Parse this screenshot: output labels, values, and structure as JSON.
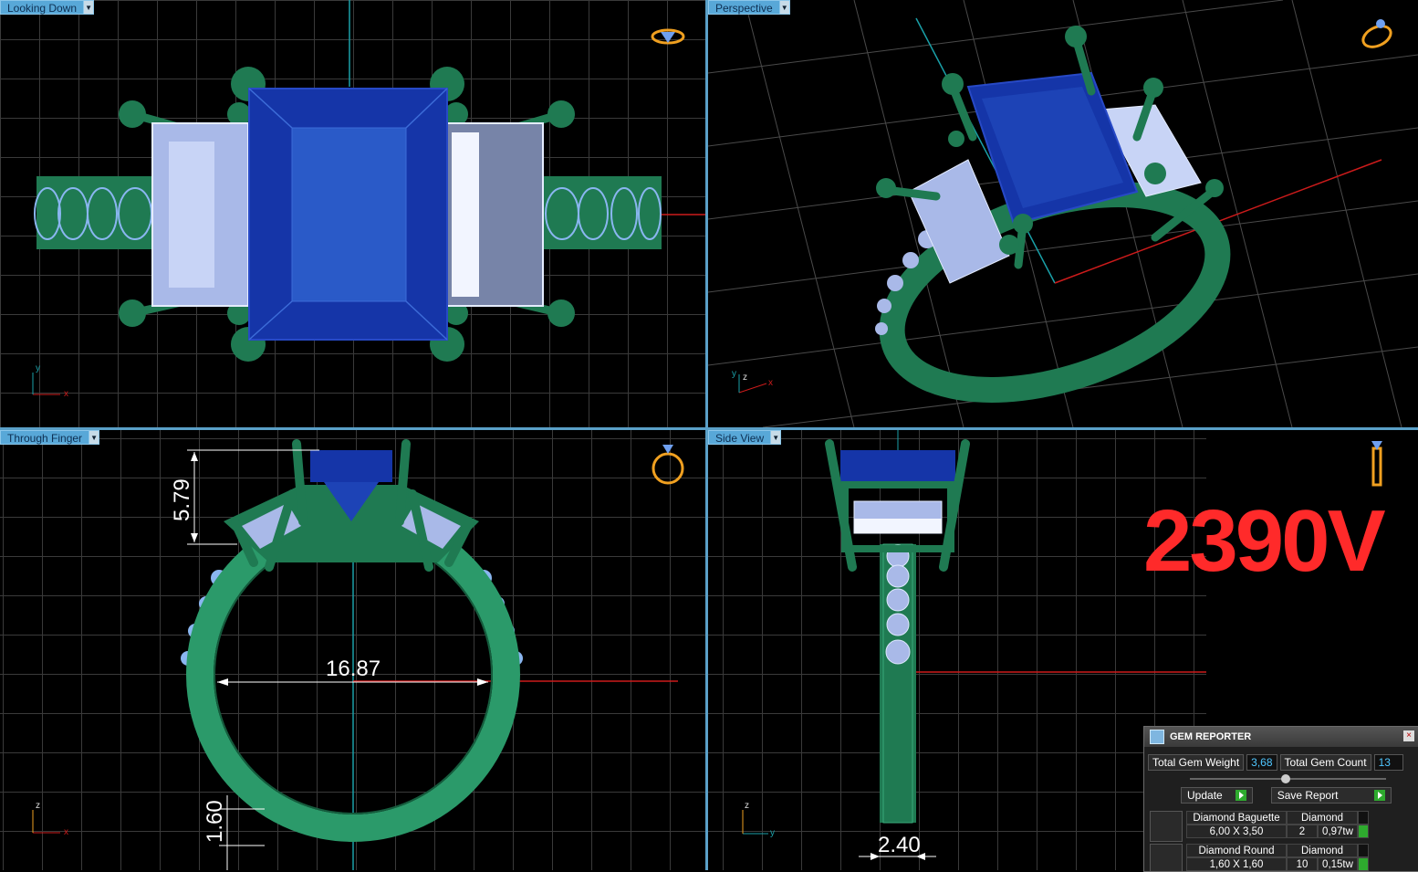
{
  "viewports": {
    "top_left": {
      "label": "Looking Down"
    },
    "top_right": {
      "label": "Perspective"
    },
    "bottom_left": {
      "label": "Through Finger"
    },
    "bottom_right": {
      "label": "Side View"
    }
  },
  "dimensions": {
    "height": "5.79",
    "inner_diameter": "16.87",
    "band_thickness": "1.60",
    "band_width": "2.40"
  },
  "model_number": "2390V",
  "axes": {
    "x": "x",
    "y": "y",
    "z": "z"
  },
  "gem_reporter": {
    "title": "GEM REPORTER",
    "close_icon": "×",
    "total_weight_label": "Total Gem Weight",
    "total_weight_value": "3,68",
    "total_count_label": "Total Gem Count",
    "total_count_value": "13",
    "update_label": "Update",
    "save_label": "Save Report",
    "gems": [
      {
        "name": "Diamond Baguette",
        "material": "Diamond",
        "size": "6,00 X 3,50",
        "count": "2",
        "weight": "0,97tw"
      },
      {
        "name": "Diamond Round",
        "material": "Diamond",
        "size": "1,60 X 1,60",
        "count": "10",
        "weight": "0,15tw"
      }
    ]
  },
  "colors": {
    "metal": "#1f7a52",
    "center_stone": "#1535a8",
    "side_stone": "#a9b9e8",
    "model_number": "#ff2a2a",
    "x_axis": "#cc1b1b",
    "y_axis": "#1aa0a8"
  }
}
